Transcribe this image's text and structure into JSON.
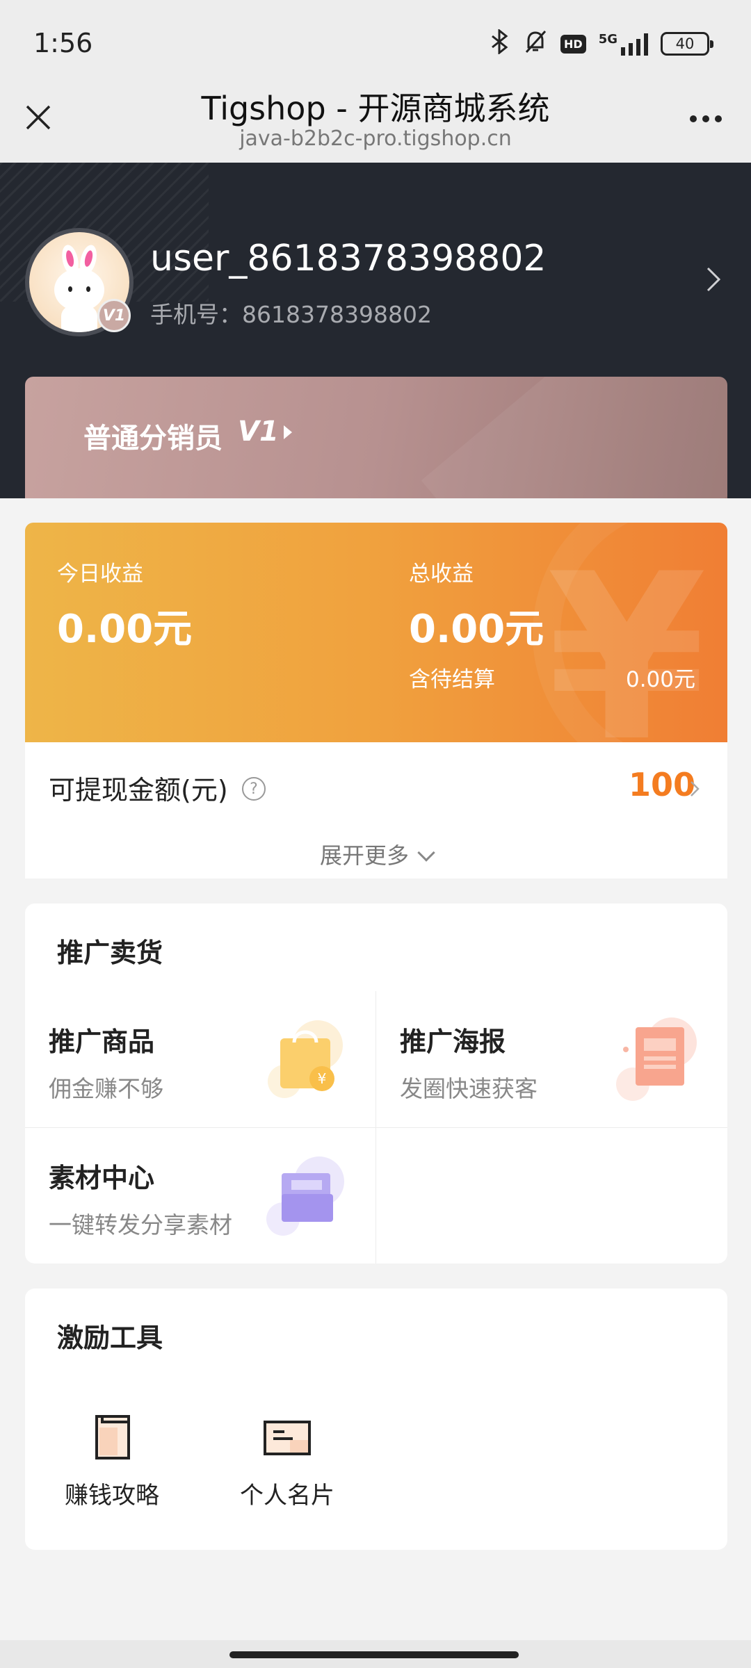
{
  "status_bar": {
    "time": "1:56",
    "network_label": "5G",
    "hd_label": "HD",
    "battery": "40"
  },
  "nav": {
    "title": "Tigshop - 开源商城系统",
    "url": "java-b2b2c-pro.tigshop.cn"
  },
  "profile": {
    "username": "user_8618378398802",
    "phone": "手机号：8618378398802",
    "level_badge": "V1"
  },
  "level_card": {
    "label": "普通分销员",
    "level": "V1"
  },
  "earnings": {
    "today_label": "今日收益",
    "today_value": "0.00元",
    "total_label": "总收益",
    "total_value": "0.00元",
    "pending_label": "含待结算",
    "pending_value": "0.00元",
    "watermark": "¥"
  },
  "withdraw": {
    "label": "可提现金额(元)",
    "help": "?",
    "value": "100",
    "expand_label": "展开更多"
  },
  "promote": {
    "title": "推广卖货",
    "items": [
      {
        "title": "推广商品",
        "subtitle": "佣金赚不够",
        "icon": "shopping-bag-icon"
      },
      {
        "title": "推广海报",
        "subtitle": "发圈快速获客",
        "icon": "poster-icon"
      },
      {
        "title": "素材中心",
        "subtitle": "一键转发分享素材",
        "icon": "folder-icon"
      }
    ]
  },
  "tools": {
    "title": "激励工具",
    "items": [
      {
        "label": "赚钱攻略",
        "icon": "book-icon"
      },
      {
        "label": "个人名片",
        "icon": "card-icon"
      }
    ]
  },
  "colors": {
    "header_bg": "#242830",
    "accent_orange": "#f47c20",
    "earn_gradient_start": "#eeb548",
    "earn_gradient_end": "#f07e34",
    "level_card": "#b79190"
  }
}
